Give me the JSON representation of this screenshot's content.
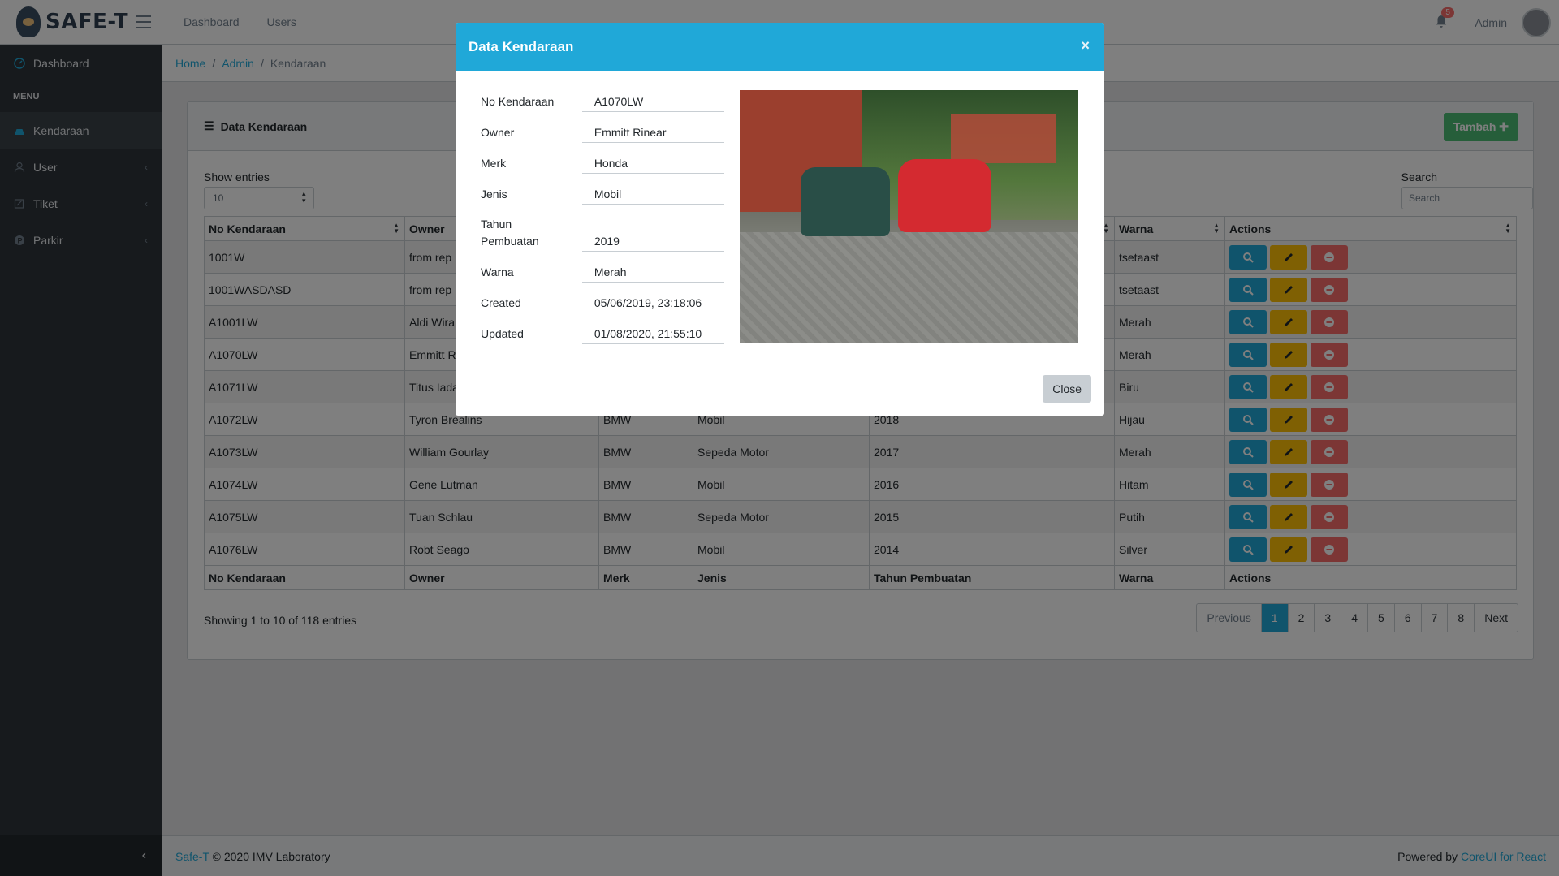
{
  "brand": {
    "name": "SAFE-T"
  },
  "header": {
    "nav": [
      "Dashboard",
      "Users"
    ],
    "notifications": "5",
    "user": "Admin"
  },
  "sidebar": {
    "dashboard": "Dashboard",
    "menu_title": "MENU",
    "items": [
      {
        "label": "Kendaraan",
        "icon": "car-icon",
        "active": true
      },
      {
        "label": "User",
        "icon": "user-icon",
        "has_submenu": true
      },
      {
        "label": "Tiket",
        "icon": "ticket-icon",
        "has_submenu": true
      },
      {
        "label": "Parkir",
        "icon": "parking-icon",
        "has_submenu": true
      }
    ]
  },
  "breadcrumb": {
    "home": "Home",
    "admin": "Admin",
    "current": "Kendaraan"
  },
  "card": {
    "title": "Data Kendaraan",
    "add_button": "Tambah",
    "show_entries": "Show entries",
    "entries_value": "10",
    "search_label": "Search",
    "search_placeholder": "Search",
    "showing": "Showing 1 to 10 of 118 entries"
  },
  "table": {
    "headers": [
      "No Kendaraan",
      "Owner",
      "Merk",
      "Jenis",
      "Tahun Pembuatan",
      "Warna",
      "Actions"
    ],
    "rows": [
      {
        "no": "1001W",
        "owner": "from rep",
        "merk": "",
        "jenis": "",
        "tahun": "",
        "warna": "tsetaast"
      },
      {
        "no": "1001WASDASD",
        "owner": "from rep",
        "merk": "",
        "jenis": "",
        "tahun": "",
        "warna": "tsetaast"
      },
      {
        "no": "A1001LW",
        "owner": "Aldi Wira",
        "merk": "",
        "jenis": "",
        "tahun": "",
        "warna": "Merah"
      },
      {
        "no": "A1070LW",
        "owner": "Emmitt R",
        "merk": "",
        "jenis": "",
        "tahun": "",
        "warna": "Merah"
      },
      {
        "no": "A1071LW",
        "owner": "Titus Iada",
        "merk": "",
        "jenis": "",
        "tahun": "",
        "warna": "Biru"
      },
      {
        "no": "A1072LW",
        "owner": "Tyron Brealins",
        "merk": "BMW",
        "jenis": "Mobil",
        "tahun": "2018",
        "warna": "Hijau"
      },
      {
        "no": "A1073LW",
        "owner": "William Gourlay",
        "merk": "BMW",
        "jenis": "Sepeda Motor",
        "tahun": "2017",
        "warna": "Merah"
      },
      {
        "no": "A1074LW",
        "owner": "Gene Lutman",
        "merk": "BMW",
        "jenis": "Mobil",
        "tahun": "2016",
        "warna": "Hitam"
      },
      {
        "no": "A1075LW",
        "owner": "Tuan Schlau",
        "merk": "BMW",
        "jenis": "Sepeda Motor",
        "tahun": "2015",
        "warna": "Putih"
      },
      {
        "no": "A1076LW",
        "owner": "Robt Seago",
        "merk": "BMW",
        "jenis": "Mobil",
        "tahun": "2014",
        "warna": "Silver"
      }
    ]
  },
  "pagination": {
    "previous": "Previous",
    "pages": [
      "1",
      "2",
      "3",
      "4",
      "5",
      "6",
      "7",
      "8"
    ],
    "current": "1",
    "next": "Next"
  },
  "footer": {
    "brand_link": "Safe-T",
    "copyright": "© 2020 IMV Laboratory",
    "powered": "Powered by",
    "powered_link": "CoreUI for React"
  },
  "modal": {
    "title": "Data Kendaraan",
    "close_x": "×",
    "fields": [
      {
        "label": "No Kendaraan",
        "value": "A1070LW"
      },
      {
        "label": "Owner",
        "value": "Emmitt Rinear"
      },
      {
        "label": "Merk",
        "value": "Honda"
      },
      {
        "label": "Jenis",
        "value": "Mobil"
      },
      {
        "label": "Tahun Pembuatan",
        "value": "2019"
      },
      {
        "label": "Warna",
        "value": "Merah"
      },
      {
        "label": "Created",
        "value": "05/06/2019, 23:18:06"
      },
      {
        "label": "Updated",
        "value": "01/08/2020, 21:55:10"
      }
    ],
    "close_button": "Close"
  },
  "colors": {
    "primary": "#20a8d8",
    "success": "#4dbd74",
    "warning": "#ffc107",
    "danger": "#f86c6b",
    "sidebar": "#2f353a"
  }
}
